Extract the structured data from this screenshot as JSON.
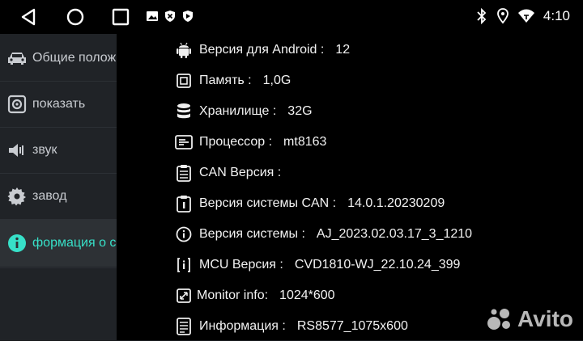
{
  "status": {
    "time": "4:10"
  },
  "sidebar": {
    "items": [
      {
        "label": "Общие полож",
        "icon": "car-icon"
      },
      {
        "label": "показать",
        "icon": "display-icon"
      },
      {
        "label": "звук",
        "icon": "speaker-icon"
      },
      {
        "label": "завод",
        "icon": "gear-icon"
      },
      {
        "label": "формация о с",
        "icon": "info-icon",
        "active": true
      }
    ],
    "accent": "#37e0c8"
  },
  "info": {
    "rows": [
      {
        "key": "Версия для Android :",
        "value": "12",
        "icon": "android-icon"
      },
      {
        "key": "Память :",
        "value": "1,0G",
        "icon": "memory-chip-icon"
      },
      {
        "key": "Хранилище :",
        "value": "32G",
        "icon": "storage-icon"
      },
      {
        "key": "Процессор :",
        "value": "mt8163",
        "icon": "processor-icon"
      },
      {
        "key": "CAN Версия :",
        "value": "",
        "icon": "can-icon"
      },
      {
        "key": "Версия системы CAN :",
        "value": "14.0.1.20230209",
        "icon": "can-system-icon"
      },
      {
        "key": "Версия системы :",
        "value": "AJ_2023.02.03.17_3_1210",
        "icon": "info-circle-icon"
      },
      {
        "key": "MCU Версия :",
        "value": "CVD1810-WJ_22.10.24_399",
        "icon": "mcu-icon"
      },
      {
        "key": "Monitor info:",
        "value": "1024*600",
        "icon": "monitor-resize-icon"
      },
      {
        "key": "Информация :",
        "value": "RS8577_1075x600",
        "icon": "document-icon"
      }
    ]
  },
  "watermark": {
    "text": "Avito"
  }
}
